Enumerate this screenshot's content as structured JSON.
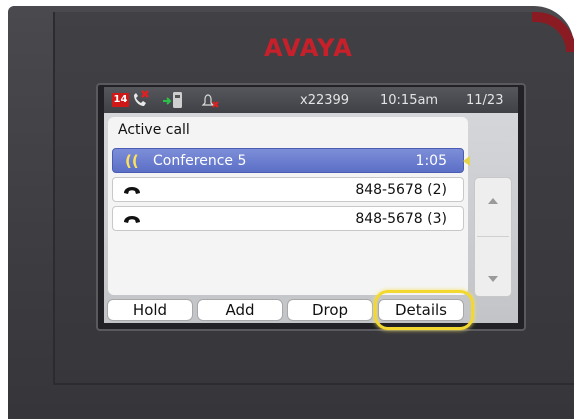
{
  "brand": {
    "logo_text": "AVAYA",
    "logo_color": "#c8202a"
  },
  "status_bar": {
    "missed_count": "14",
    "extension": "x22399",
    "time": "10:15am",
    "date": "11/23",
    "icons": [
      "missed-call-icon",
      "call-forward-icon",
      "ringer-off-icon"
    ]
  },
  "panel": {
    "title": "Active call",
    "calls": [
      {
        "label": "Conference 5",
        "duration": "1:05",
        "icon": "conference-icon",
        "active": true
      },
      {
        "number": "848-5678 (2)",
        "icon": "handset-icon"
      },
      {
        "number": "848-5678 (3)",
        "icon": "handset-icon"
      }
    ]
  },
  "softkeys": {
    "hold": "Hold",
    "add": "Add",
    "drop": "Drop",
    "details": "Details"
  },
  "colors": {
    "active_row": "#6a7ed0",
    "highlight": "#f3d82f",
    "missed_badge": "#d01818"
  }
}
